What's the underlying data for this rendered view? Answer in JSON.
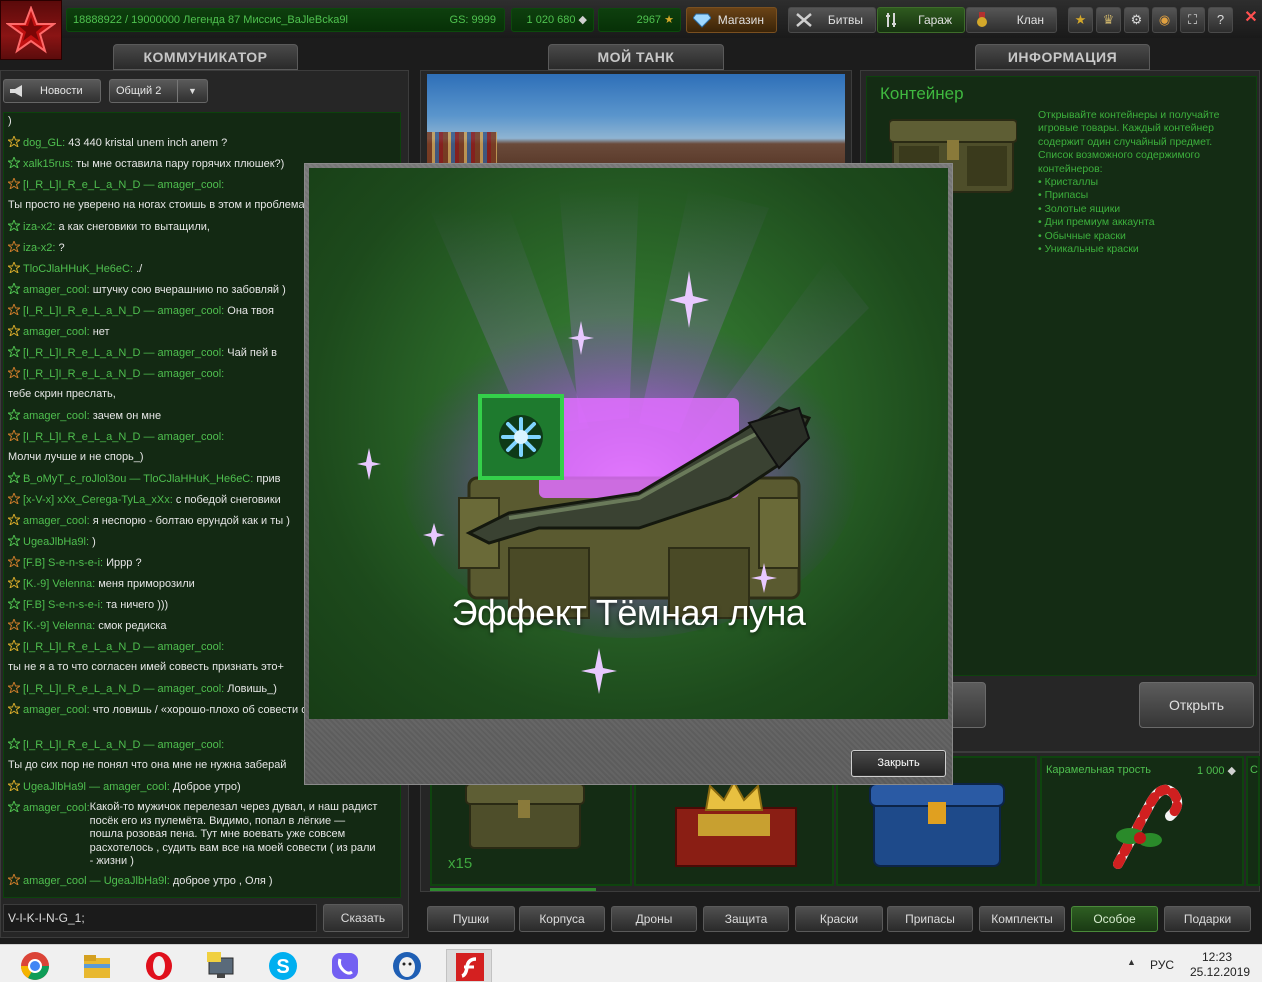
{
  "topbar": {
    "rank_text": "18888922 / 19000000  Легенда 87 Mиссис_BaJleBcka9l",
    "gs_text": "GS: 9999",
    "crystals": "1 020 680",
    "stars": "2967",
    "shop_label": "Магазин",
    "battles_label": "Битвы",
    "garage_label": "Гараж",
    "clan_label": "Клан",
    "help_label": "?",
    "close_label": "✕"
  },
  "tabs": {
    "communicator": "КОММУНИКАТОР",
    "my_tank": "МОЙ ТАНК",
    "information": "ИНФОРМАЦИЯ"
  },
  "comm": {
    "news_label": "Новости",
    "channel_value": "Общий 2",
    "input_value": "V-I-K-I-N-G_1;",
    "send_label": "Сказать"
  },
  "chat": [
    {
      "parts": [
        {
          "t": "text",
          "v": ")"
        }
      ]
    },
    {
      "parts": [
        {
          "t": "nick",
          "v": "dog_GL:"
        },
        {
          "t": "text",
          "v": " 43 440 kristal unem inch anem ?"
        }
      ]
    },
    {
      "parts": [
        {
          "t": "nick",
          "v": "xalk15rus:"
        },
        {
          "t": "text",
          "v": " ты мне оставила пару горячих плюшек?)"
        }
      ]
    },
    {
      "parts": [
        {
          "t": "nick",
          "v": "[I_R_L]I_R_e_L_a_N_D"
        },
        {
          "t": "sep",
          "v": " — "
        },
        {
          "t": "nick",
          "v": "amager_cool:"
        }
      ]
    },
    {
      "parts": [
        {
          "t": "text",
          "v": "Ты просто не уверено на ногах стоишь в этом и проблема"
        }
      ]
    },
    {
      "parts": [
        {
          "t": "nick",
          "v": "iza-x2:"
        },
        {
          "t": "text",
          "v": " а как снеговики то вытащили,"
        }
      ]
    },
    {
      "parts": [
        {
          "t": "nick",
          "v": "iza-x2:"
        },
        {
          "t": "text",
          "v": " ?"
        }
      ]
    },
    {
      "parts": [
        {
          "t": "nick",
          "v": "TloCJlaHHuK_He6eC:"
        },
        {
          "t": "text",
          "v": " ./"
        }
      ]
    },
    {
      "parts": [
        {
          "t": "nick",
          "v": "amager_cool:"
        },
        {
          "t": "text",
          "v": " штучку сою вчерашнию по забовляй )"
        }
      ]
    },
    {
      "parts": [
        {
          "t": "nick",
          "v": "[I_R_L]I_R_e_L_a_N_D"
        },
        {
          "t": "sep",
          "v": " — "
        },
        {
          "t": "nick",
          "v": "amager_cool:"
        },
        {
          "t": "text",
          "v": " Она твоя"
        }
      ]
    },
    {
      "parts": [
        {
          "t": "nick",
          "v": "amager_cool:"
        },
        {
          "t": "text",
          "v": " нет"
        }
      ]
    },
    {
      "parts": [
        {
          "t": "nick",
          "v": "[I_R_L]I_R_e_L_a_N_D"
        },
        {
          "t": "sep",
          "v": " — "
        },
        {
          "t": "nick",
          "v": "amager_cool:"
        },
        {
          "t": "text",
          "v": " Чай пей в"
        }
      ]
    },
    {
      "parts": [
        {
          "t": "nick",
          "v": "[I_R_L]I_R_e_L_a_N_D"
        },
        {
          "t": "sep",
          "v": " — "
        },
        {
          "t": "nick",
          "v": "amager_cool:"
        }
      ]
    },
    {
      "parts": [
        {
          "t": "text",
          "v": "тебе скрин преслать,"
        }
      ]
    },
    {
      "parts": [
        {
          "t": "nick",
          "v": "amager_cool:"
        },
        {
          "t": "text",
          "v": " зачем он мне"
        }
      ]
    },
    {
      "parts": [
        {
          "t": "nick",
          "v": "[I_R_L]I_R_e_L_a_N_D"
        },
        {
          "t": "sep",
          "v": " — "
        },
        {
          "t": "nick",
          "v": "amager_cool:"
        }
      ]
    },
    {
      "parts": [
        {
          "t": "text",
          "v": "Молчи лучше и не спорь_)"
        }
      ]
    },
    {
      "parts": [
        {
          "t": "nick",
          "v": "B_oMyT_c_roJlol3ou"
        },
        {
          "t": "sep",
          "v": " — "
        },
        {
          "t": "nick",
          "v": "TloCJlaHHuK_He6eC:"
        },
        {
          "t": "text",
          "v": " прив"
        }
      ]
    },
    {
      "parts": [
        {
          "t": "nick",
          "v": "[x-V-x] xXx_Cerega-TyLa_xXx:"
        },
        {
          "t": "text",
          "v": " с победой снеговики"
        }
      ]
    },
    {
      "parts": [
        {
          "t": "nick",
          "v": "amager_cool:"
        },
        {
          "t": "text",
          "v": " я неспорю - болтаю ерундой как и ты )"
        }
      ]
    },
    {
      "parts": [
        {
          "t": "nick",
          "v": "UgeaJlbHa9l:"
        },
        {
          "t": "text",
          "v": " )"
        }
      ]
    },
    {
      "parts": [
        {
          "t": "nick",
          "v": "[F.B] S-e-n-s-e-i:"
        },
        {
          "t": "text",
          "v": " Иррр ?"
        }
      ]
    },
    {
      "parts": [
        {
          "t": "nick",
          "v": "[K.-9] Velenna:"
        },
        {
          "t": "text",
          "v": " меня приморозили"
        }
      ]
    },
    {
      "parts": [
        {
          "t": "nick",
          "v": "[F.B] S-e-n-s-e-i:"
        },
        {
          "t": "text",
          "v": " та ничего )))"
        }
      ]
    },
    {
      "parts": [
        {
          "t": "nick",
          "v": "[K.-9] Velenna:"
        },
        {
          "t": "text",
          "v": " смок редиска"
        }
      ]
    },
    {
      "parts": [
        {
          "t": "nick",
          "v": "[I_R_L]I_R_e_L_a_N_D"
        },
        {
          "t": "sep",
          "v": " — "
        },
        {
          "t": "nick",
          "v": "amager_cool:"
        }
      ]
    },
    {
      "parts": [
        {
          "t": "text",
          "v": "ты не я а то что согласен имей совесть признать это+"
        }
      ]
    },
    {
      "parts": [
        {
          "t": "nick",
          "v": "[I_R_L]I_R_e_L_a_N_D"
        },
        {
          "t": "sep",
          "v": " — "
        },
        {
          "t": "nick",
          "v": "amager_cool:"
        },
        {
          "t": "text",
          "v": " Ловишь_)"
        }
      ]
    },
    {
      "parts": [
        {
          "t": "nick",
          "v": "amager_cool:"
        },
        {
          "t": "text",
          "v": " что ловишь / «хорошо-плохо об совести от наших поступков"
        }
      ]
    },
    {
      "parts": [
        {
          "t": "nick",
          "v": "[I_R_L]I_R_e_L_a_N_D"
        },
        {
          "t": "sep",
          "v": " — "
        },
        {
          "t": "nick",
          "v": "amager_cool:"
        }
      ]
    },
    {
      "parts": [
        {
          "t": "text",
          "v": "Ты до сих пор не понял что она мне не нужна заберай"
        }
      ]
    },
    {
      "parts": [
        {
          "t": "nick",
          "v": "UgeaJlbHa9l"
        },
        {
          "t": "sep",
          "v": " — "
        },
        {
          "t": "nick",
          "v": "amager_cool:"
        },
        {
          "t": "text",
          "v": " Доброе утро)"
        }
      ]
    },
    {
      "parts": [
        {
          "t": "nick",
          "v": "amager_cool:"
        },
        {
          "t": "text",
          "v": " Какой-то мужичок перелезал через дувал, и наш радист посёк его из пулемёта. Видимо, попал в лёгкие — пошла розовая пена. Тут мне воевать уже совсем расхотелось , судить вам все на моей совести ( из рали - жизни )"
        }
      ]
    },
    {
      "parts": [
        {
          "t": "nick",
          "v": "amager_cool"
        },
        {
          "t": "sep",
          "v": " — "
        },
        {
          "t": "nick",
          "v": "UgeaJlbHa9l:"
        },
        {
          "t": "text",
          "v": " доброе утро , Оля )"
        }
      ]
    }
  ],
  "info": {
    "title": "Контейнер",
    "description": "Открывайте контейнеры и получайте игровые товары. Каждый контейнер содержит один случайный предмет. Список возможного содержимого контейнеров:",
    "items": [
      "• Кристаллы",
      "• Припасы",
      "• Золотые ящики",
      "• Дни премиум аккаунта",
      "• Обычные краски",
      "• Уникальные краски"
    ],
    "open_label": "Открыть"
  },
  "shop_items": {
    "item1_badge": "x15",
    "item3_frag": "р",
    "item4_name": "Карамельная трость",
    "item4_price": "1 000",
    "item5_name": "С"
  },
  "categories": [
    "Пушки",
    "Корпуса",
    "Дроны",
    "Защита",
    "Краски",
    "Припасы",
    "Комплекты",
    "Особое",
    "Подарки"
  ],
  "active_category": "Особое",
  "modal": {
    "reward_name": "Эффект Тёмная луна",
    "close_label": "Закрыть"
  },
  "taskbar": {
    "lang": "РУС",
    "time": "12:23",
    "date": "25.12.2019"
  },
  "colors": {
    "accent_green": "#4fbf4f",
    "panel_green": "#142c14",
    "glow_purple": "#c86cff"
  }
}
